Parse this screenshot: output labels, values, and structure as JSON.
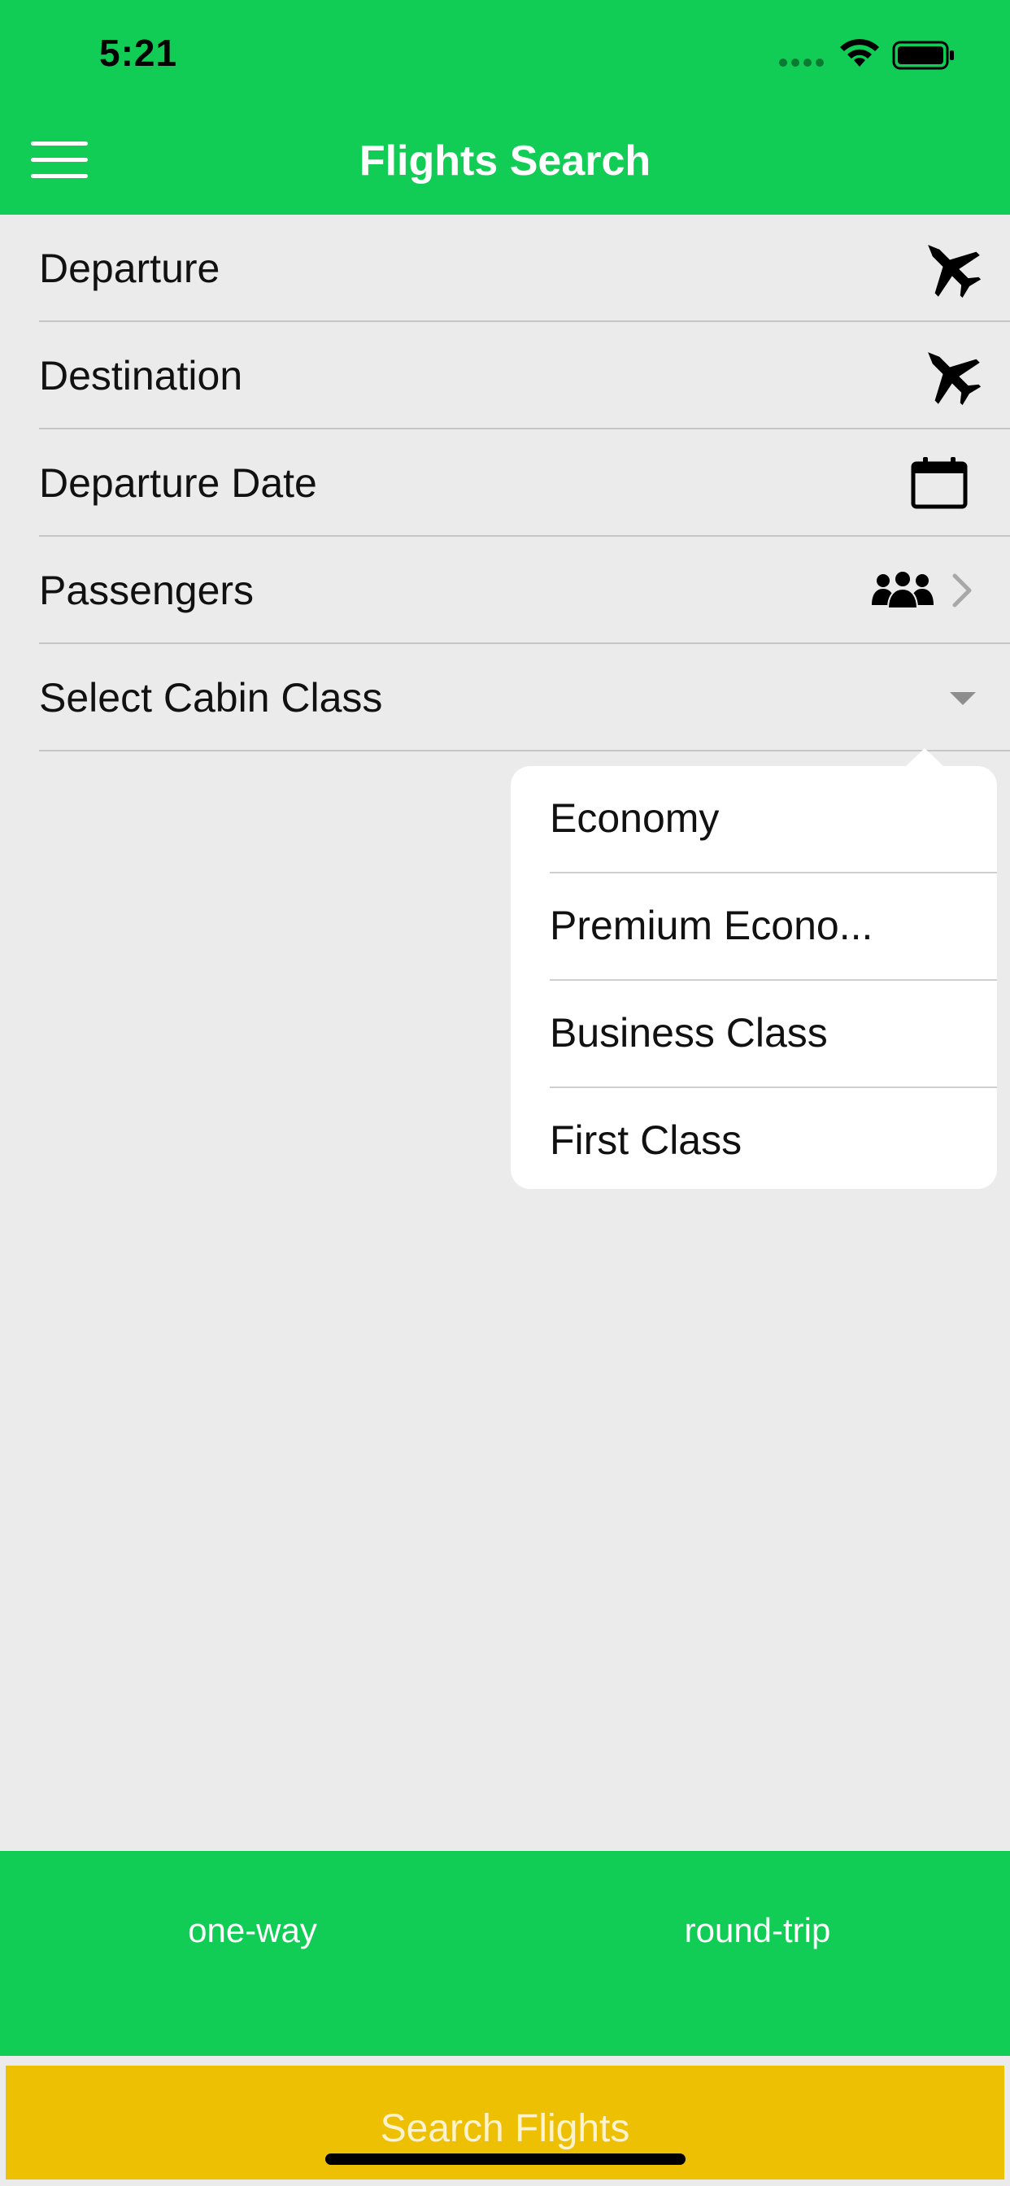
{
  "status_bar": {
    "time": "5:21"
  },
  "nav": {
    "title": "Flights Search",
    "menu_icon": "hamburger-menu-icon"
  },
  "form": {
    "rows": [
      {
        "label": "Departure",
        "icon": "fighter-jet-icon"
      },
      {
        "label": "Destination",
        "icon": "fighter-jet-icon"
      },
      {
        "label": "Departure Date",
        "icon": "calendar-icon"
      },
      {
        "label": "Passengers",
        "icon": "users-icon"
      },
      {
        "label": "Select Cabin Class",
        "icon": "dropdown-caret-icon"
      }
    ]
  },
  "cabin_dropdown": {
    "options": [
      "Economy",
      "Premium Econo...",
      "Business Class",
      "First Class"
    ]
  },
  "trip_type": {
    "one_way": "one-way",
    "round_trip": "round-trip"
  },
  "search_button": {
    "label": "Search Flights"
  },
  "colors": {
    "header_green": "#11cd55",
    "search_yellow": "#edc003",
    "background": "#ebebeb"
  }
}
